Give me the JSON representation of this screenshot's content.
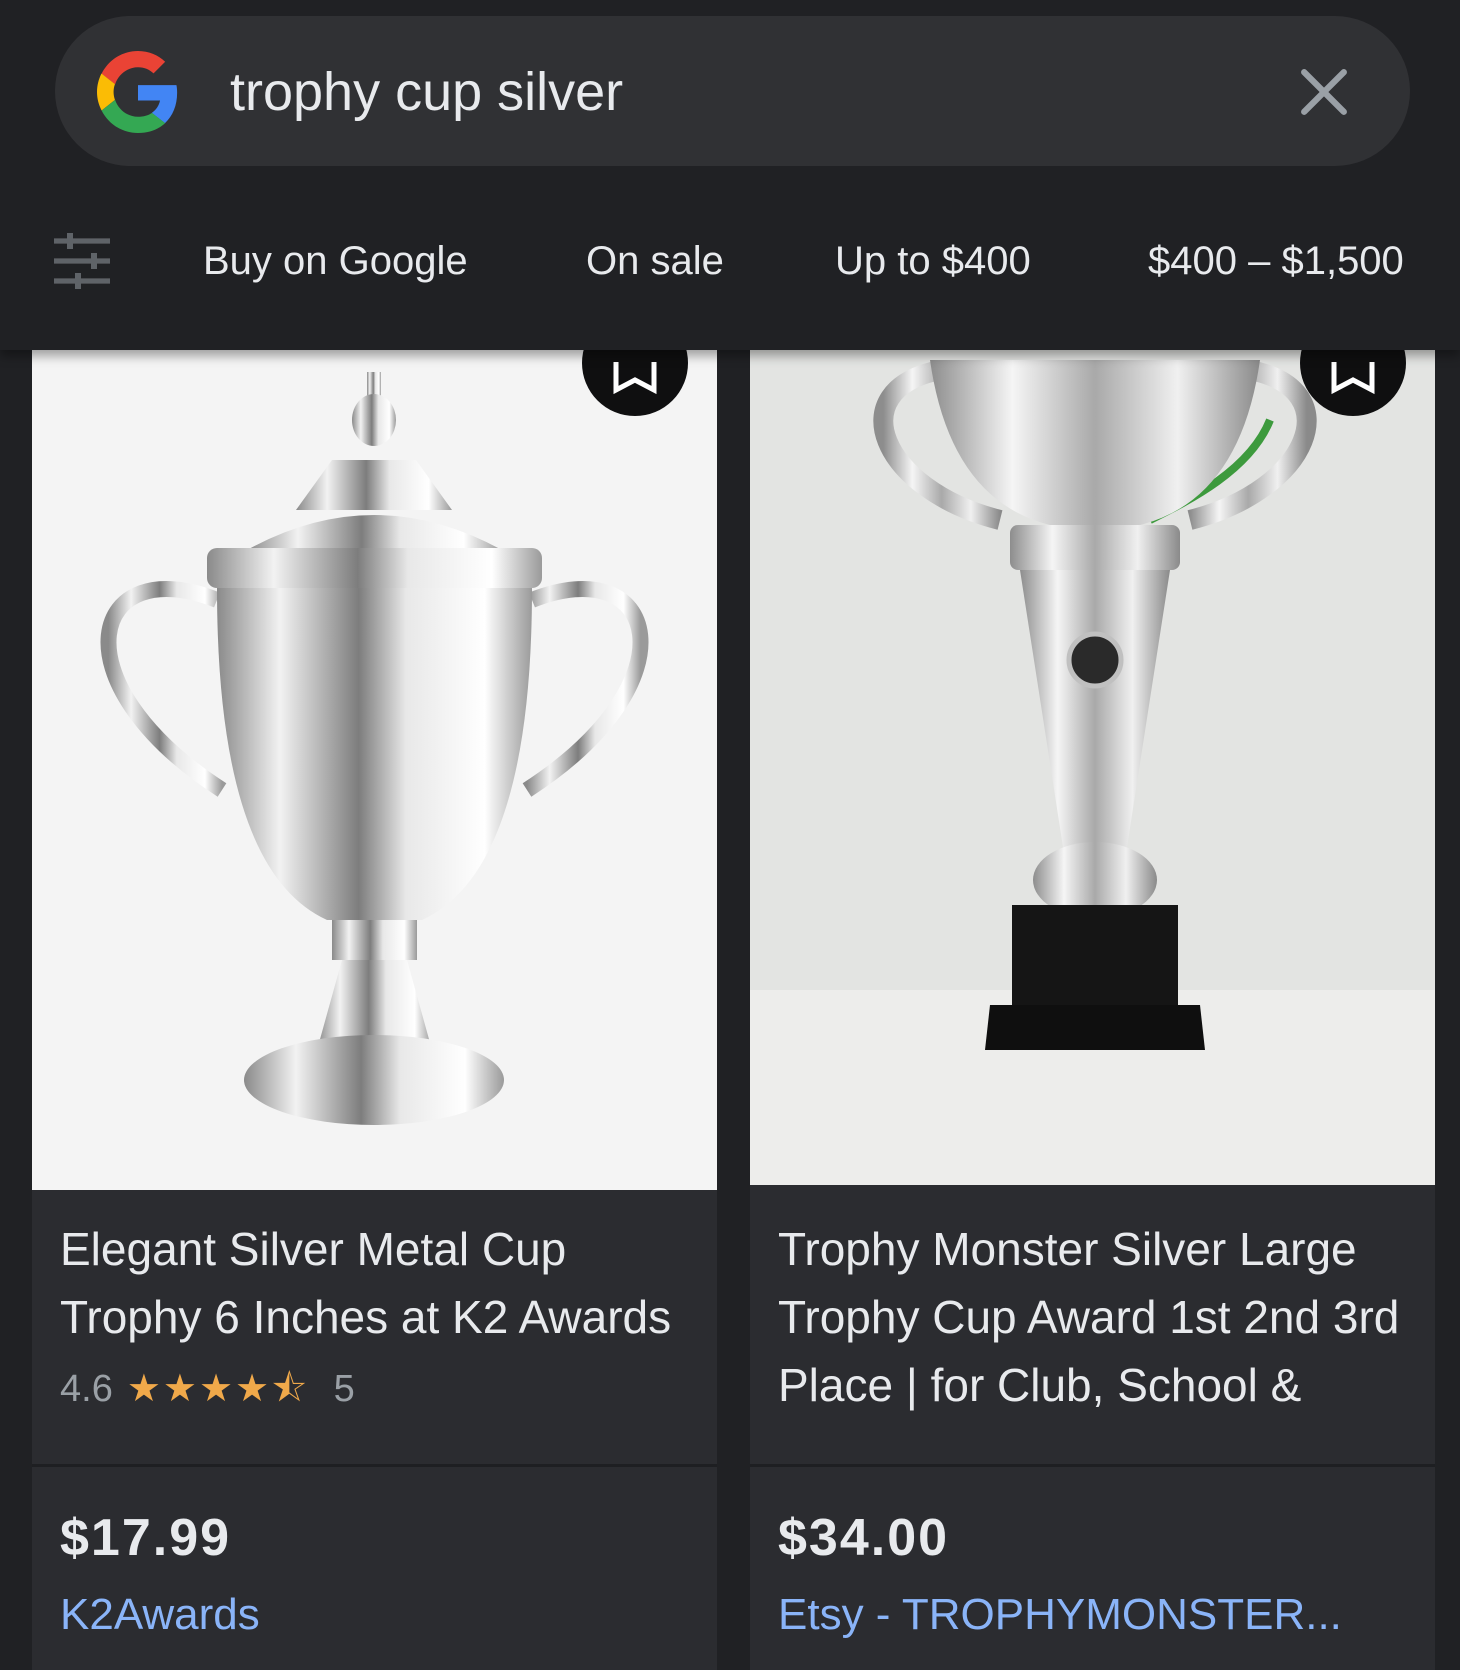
{
  "search": {
    "query": "trophy cup silver",
    "logo_icon": "google-g-icon",
    "clear_icon": "close-icon"
  },
  "filters": {
    "settings_icon": "tune-icon",
    "chips": [
      "Buy on Google",
      "On sale",
      "Up to $400",
      "$400 – $1,500"
    ]
  },
  "products": [
    {
      "title": "Elegant Silver Metal Cup Trophy 6 Inches at K2 Awards",
      "rating": "4.6",
      "stars": "★★★★⯪",
      "review_count": "5",
      "price": "$17.99",
      "seller": "K2Awards"
    },
    {
      "title": "Trophy Monster Silver Large Trophy Cup Award 1st 2nd 3rd Place | for Club, School &",
      "price": "$34.00",
      "seller": "Etsy - TROPHYMONSTER..."
    }
  ],
  "colors": {
    "background": "#202124",
    "search_bar": "#303134",
    "card": "#2b2c30",
    "link": "#8ab4f8",
    "stars": "#f0a94a"
  }
}
